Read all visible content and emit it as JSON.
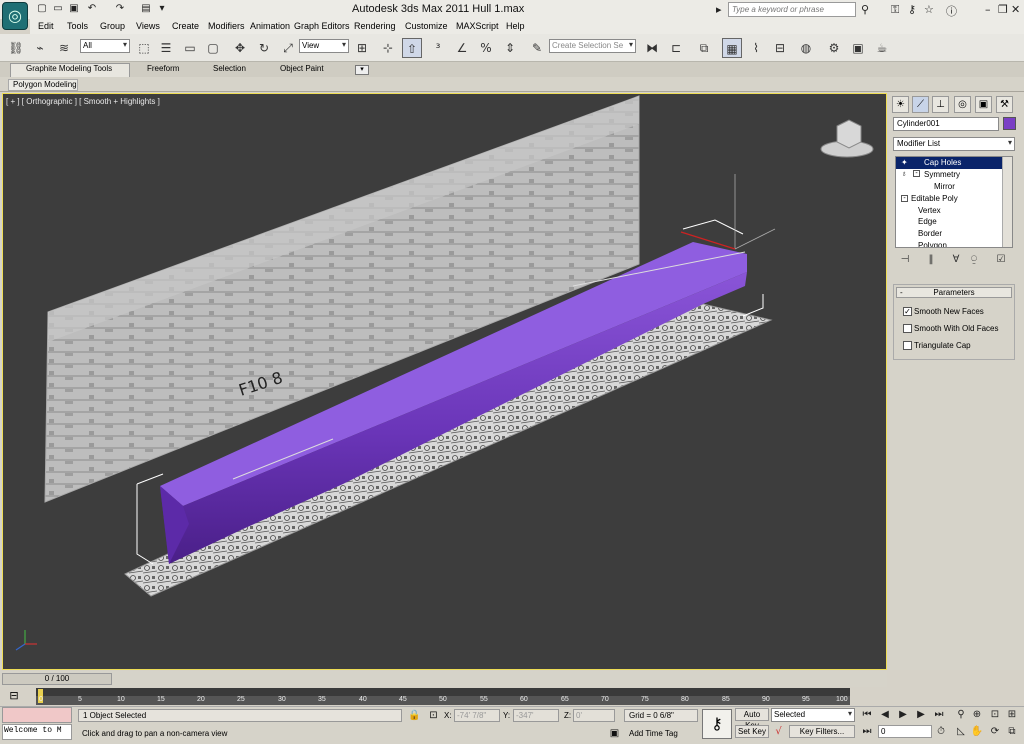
{
  "app": {
    "title": "Autodesk 3ds Max  2011     Hull 1.max",
    "search_placeholder": "Type a keyword or phrase"
  },
  "menu": [
    "Edit",
    "Tools",
    "Group",
    "Views",
    "Create",
    "Modifiers",
    "Animation",
    "Graph Editors",
    "Rendering",
    "Customize",
    "MAXScript",
    "Help"
  ],
  "toolbar": {
    "selection_filter": "All",
    "ref_coord": "View",
    "named_selection_placeholder": "Create Selection Se"
  },
  "ribbon": {
    "tabs": [
      "Graphite Modeling Tools",
      "Freeform",
      "Selection",
      "Object Paint"
    ],
    "panel": "Polygon Modeling"
  },
  "viewport": {
    "label": "[ + ] [ Orthographic ] [ Smooth + Highlights ]",
    "blueprint_text": "F10 8"
  },
  "command_panel": {
    "object_name": "Cylinder001",
    "object_color": "#7a3fc5",
    "modifier_list": "Modifier List",
    "stack": [
      {
        "label": "Cap Holes",
        "selected": true
      },
      {
        "label": "Symmetry"
      },
      {
        "label": "Mirror"
      },
      {
        "label": "Editable Poly"
      },
      {
        "label": "Vertex"
      },
      {
        "label": "Edge"
      },
      {
        "label": "Border"
      },
      {
        "label": "Polygon"
      }
    ],
    "rollout_title": "Parameters",
    "options": [
      {
        "label": "Smooth New Faces",
        "checked": true
      },
      {
        "label": "Smooth With Old Faces",
        "checked": false
      },
      {
        "label": "Triangulate Cap",
        "checked": false
      }
    ]
  },
  "timeline": {
    "slider": "0 / 100",
    "ticks": [
      "0",
      "5",
      "10",
      "15",
      "20",
      "25",
      "30",
      "35",
      "40",
      "45",
      "50",
      "55",
      "60",
      "65",
      "70",
      "75",
      "80",
      "85",
      "90",
      "95",
      "100"
    ]
  },
  "status": {
    "listener": "Welcome to M",
    "selection": "1 Object Selected",
    "prompt": "Click and drag to pan a non-camera view",
    "x_label": "X:",
    "x_value": "-74' 7/8\"",
    "y_label": "Y:",
    "y_value": "-347'",
    "z_label": "Z:",
    "z_value": "0'",
    "grid": "Grid = 0 6/8\"",
    "add_time_tag": "Add Time Tag",
    "auto_key": "Auto Key",
    "set_key": "Set Key",
    "key_mode": "Selected",
    "key_filters": "Key Filters...",
    "frame": "0"
  }
}
